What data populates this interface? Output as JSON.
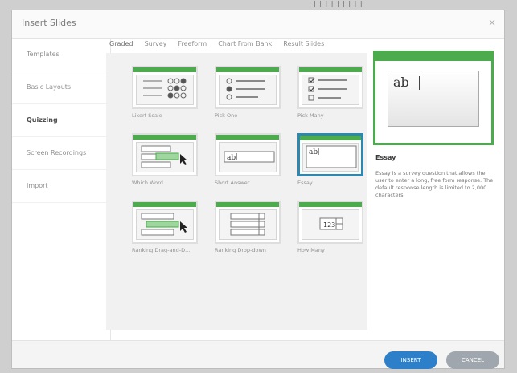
{
  "dialog": {
    "title": "Insert Slides",
    "close_icon": "×"
  },
  "topmarks": "| | | | | | | | |",
  "sidebar": {
    "items": [
      {
        "label": "Templates",
        "active": false
      },
      {
        "label": "Basic Layouts",
        "active": false
      },
      {
        "label": "Quizzing",
        "active": true
      },
      {
        "label": "Screen Recordings",
        "active": false
      },
      {
        "label": "Import",
        "active": false
      }
    ]
  },
  "tabs": [
    "Graded",
    "Survey",
    "Freeform",
    "Chart From Bank",
    "Result Slides"
  ],
  "tiles": [
    {
      "label": "Likert Scale",
      "icon": "likert-scale-icon"
    },
    {
      "label": "Pick One",
      "icon": "pick-one-icon"
    },
    {
      "label": "Pick Many",
      "icon": "pick-many-icon"
    },
    {
      "label": "Which Word",
      "icon": "which-word-icon"
    },
    {
      "label": "Short Answer",
      "icon": "short-answer-icon"
    },
    {
      "label": "Essay",
      "icon": "essay-icon"
    },
    {
      "label": "Ranking Drag-and-D...",
      "icon": "ranking-drag-drop-icon"
    },
    {
      "label": "Ranking Drop-down",
      "icon": "ranking-dropdown-icon"
    },
    {
      "label": "How Many",
      "icon": "how-many-icon"
    }
  ],
  "preview": {
    "sample_text": "ab"
  },
  "description": {
    "title": "Essay",
    "text": "Essay is a survey question that allows the user to enter a long, free form response. The default response length is limited to 2,000 characters."
  },
  "buttons": {
    "insert": "INSERT",
    "cancel": "CANCEL"
  },
  "colors": {
    "accent_green": "#4cab4c",
    "selected_blue": "#2f87b0",
    "insert_blue": "#2d7fc9"
  }
}
